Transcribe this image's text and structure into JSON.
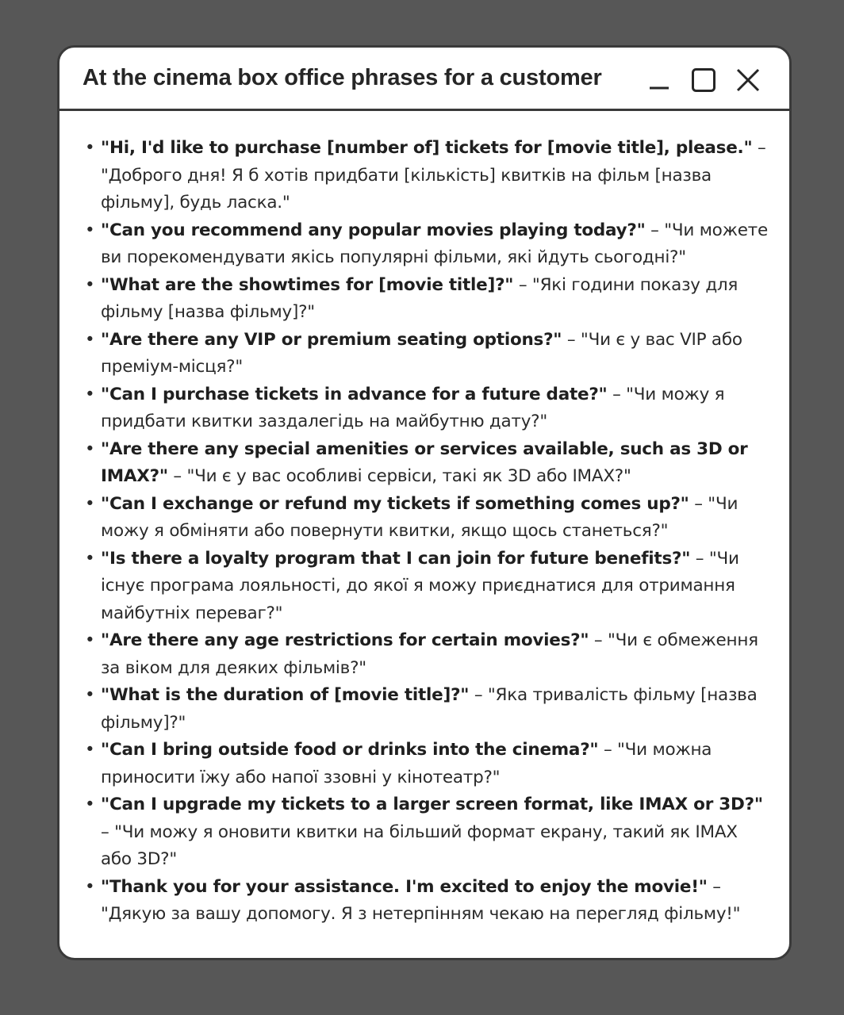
{
  "window": {
    "title": "At the cinema box office phrases for a customer",
    "controls": [
      {
        "name": "minimize-button",
        "icon": "minimize-icon"
      },
      {
        "name": "maximize-button",
        "icon": "maximize-icon"
      },
      {
        "name": "close-button",
        "icon": "close-icon"
      }
    ]
  },
  "bullet_glyph": "•",
  "phrases": [
    {
      "en": "\"Hi, I'd like to purchase [number of] tickets for [movie title], please.\"",
      "uk": " – \"Доброго дня! Я б хотів придбати [кількість] квитків на фільм [назва фільму], будь ласка.\""
    },
    {
      "en": "\"Can you recommend any popular movies playing today?\"",
      "uk": " – \"Чи можете ви порекомендувати якісь популярні фільми, які йдуть сьогодні?\""
    },
    {
      "en": "\"What are the showtimes for [movie title]?\"",
      "uk": " – \"Які години показу для фільму [назва фільму]?\""
    },
    {
      "en": "\"Are there any VIP or premium seating options?\"",
      "uk": " – \"Чи є у вас VIP або преміум-місця?\""
    },
    {
      "en": "\"Can I purchase tickets in advance for a future date?\"",
      "uk": " – \"Чи можу я придбати квитки заздалегідь на майбутню дату?\""
    },
    {
      "en": "\"Are there any special amenities or services available, such as 3D or IMAX?\"",
      "uk": " – \"Чи є у вас особливі сервіси, такі як 3D або IMAX?\""
    },
    {
      "en": "\"Can I exchange or refund my tickets if something comes up?\"",
      "uk": " – \"Чи можу я обміняти або повернути квитки, якщо щось станеться?\""
    },
    {
      "en": "\"Is there a loyalty program that I can join for future benefits?\"",
      "uk": " – \"Чи існує програма лояльності, до якої я можу приєднатися для отримання майбутніх переваг?\""
    },
    {
      "en": "\"Are there any age restrictions for certain movies?\"",
      "uk": " – \"Чи є обмеження за віком для деяких фільмів?\""
    },
    {
      "en": "\"What is the duration of [movie title]?\"",
      "uk": " – \"Яка тривалість фільму [назва фільму]?\""
    },
    {
      "en": "\"Can I bring outside food or drinks into the cinema?\"",
      "uk": " – \"Чи можна приносити їжу або напої ззовні у кінотеатр?\""
    },
    {
      "en": "\"Can I upgrade my tickets to a larger screen format, like IMAX or 3D?\"",
      "uk": " – \"Чи можу я оновити квитки на більший формат екрану, такий як IMAX або 3D?\""
    },
    {
      "en": "\"Thank you for your assistance. I'm excited to enjoy the movie!\"",
      "uk": " – \"Дякую за вашу допомогу. Я з нетерпінням чекаю на перегляд фільму!\""
    }
  ],
  "colors": {
    "background": "#575757",
    "window": "#ffffff",
    "border": "#3a3a3a",
    "text": "#262626"
  }
}
